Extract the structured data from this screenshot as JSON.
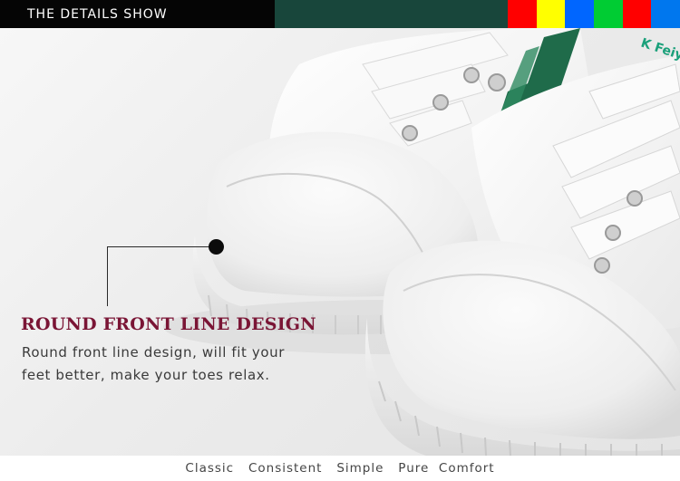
{
  "header": {
    "title": "THE DETAILS SHOW",
    "swatch_colors": [
      "#ff0000",
      "#ffff00",
      "#0066ff",
      "#00cc33",
      "#ff0000",
      "#0077ee"
    ]
  },
  "colors": {
    "header_black": "#050505",
    "header_green": "#18463b",
    "title_accent": "#7a1535"
  },
  "photo": {
    "subject": "white canvas sneakers with green chevron stripe"
  },
  "feature": {
    "title": "ROUND FRONT LINE DESIGN",
    "description": "Round front line design, will fit your feet better, make your toes relax."
  },
  "footer": {
    "tagline": "Classic   Consistent   Simple   Pure  Comfort"
  }
}
